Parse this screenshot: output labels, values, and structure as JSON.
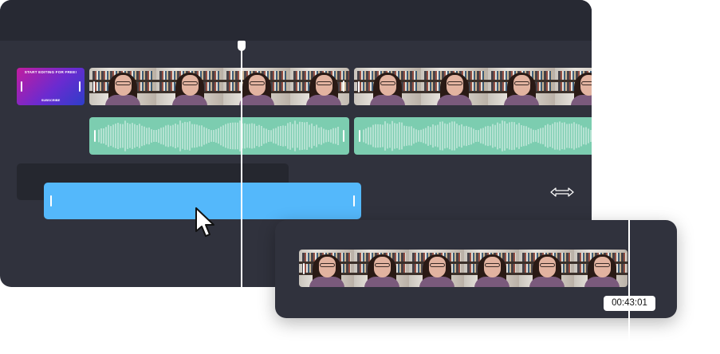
{
  "timeline": {
    "title_card": {
      "heading": "START EDITING FOR FREE!",
      "subtitle": "SUBSCRIBE"
    },
    "tracks": [
      {
        "kind": "title-card"
      },
      {
        "kind": "video"
      },
      {
        "kind": "audio"
      },
      {
        "kind": "overlay"
      }
    ]
  },
  "preview": {
    "timestamp": "00:43:01"
  },
  "icons": {
    "cursor": "mouse-pointer-icon",
    "resize": "horizontal-resize-icon"
  },
  "colors": {
    "editor_bg": "#30323d",
    "topbar_bg": "#272933",
    "audio_clip": "#7ccdb0",
    "selected_clip": "#54b8fb",
    "title_card_gradient": [
      "#c21c9f",
      "#2d3ec9"
    ]
  }
}
